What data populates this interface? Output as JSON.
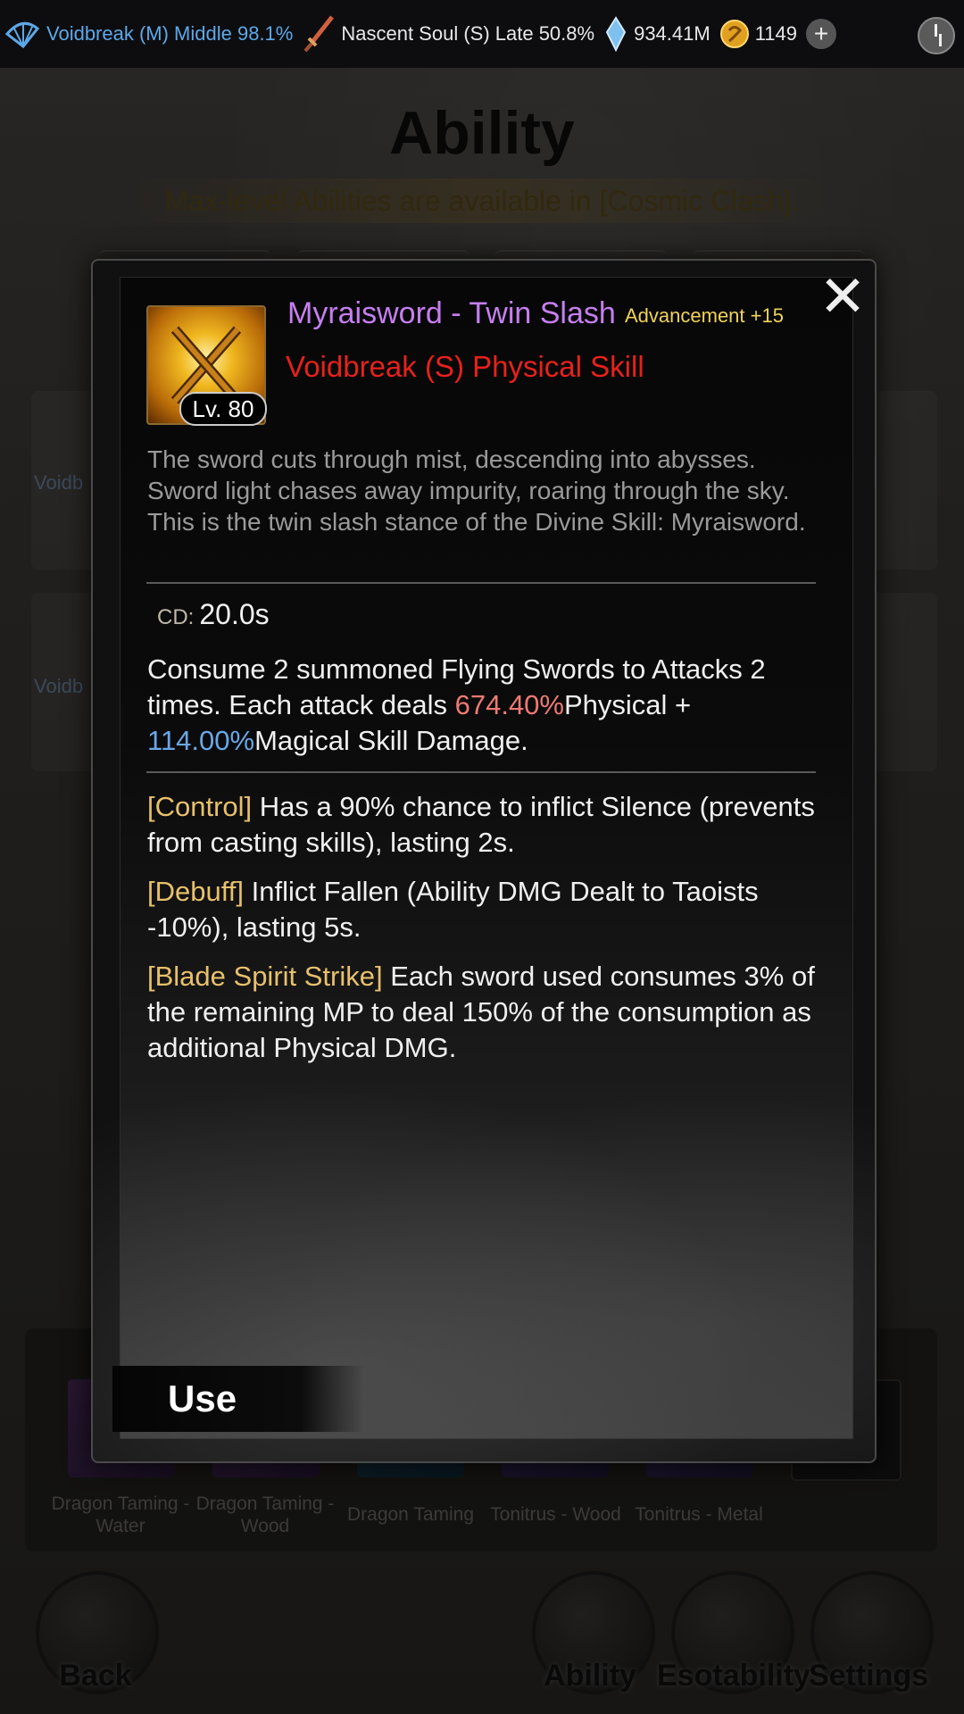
{
  "status_bar": {
    "realm": "Voidbreak (M) Middle 98.1%",
    "soul": "Nascent Soul (S) Late 50.8%",
    "crystals": "934.41M",
    "currency": "1149"
  },
  "page": {
    "title": "Ability",
    "subtitle": "Max-level Abilities are available in [Cosmic Clash].",
    "row_label_1": "Voidb",
    "row_label_2": "Voidb"
  },
  "bottom_slots": [
    {
      "label": "Dragon Taming - Water"
    },
    {
      "label": "Dragon Taming - Wood"
    },
    {
      "label": "Dragon Taming"
    },
    {
      "label": "Tonitrus - Wood"
    },
    {
      "label": "Tonitrus - Metal"
    }
  ],
  "bottom_nav": {
    "back": "Back",
    "ability": "Ability",
    "esotability": "Esotability",
    "settings": "Settings"
  },
  "modal": {
    "skill_name": "Myraisword - Twin Slash",
    "advancement": "Advancement +15",
    "skill_type": "Voidbreak (S) Physical Skill",
    "level": "Lv. 80",
    "description": "The sword cuts through mist, descending into abysses. Sword light chases away impurity, roaring through the sky. This is the twin slash stance of the Divine Skill: Myraisword.",
    "cd_label": "CD:",
    "cd_value": "20.0s",
    "main_effect": {
      "part1": "Consume 2 summoned Flying Swords to Attacks 2 times. Each attack deals ",
      "physical_pct": "674.40%",
      "part2": "Physical + ",
      "magical_pct": "114.00%",
      "part3": "Magical Skill Damage."
    },
    "effects": [
      {
        "tag": "[Control]",
        "text": " Has a 90% chance to inflict Silence (prevents from casting skills), lasting 2s."
      },
      {
        "tag": "[Debuff]",
        "text": " Inflict Fallen (Ability DMG Dealt to Taoists -10%), lasting 5s."
      },
      {
        "tag": "[Blade Spirit Strike]",
        "text": " Each sword used consumes 3% of the remaining MP to deal 150% of the consumption as additional Physical DMG."
      }
    ],
    "use_label": "Use",
    "close_symbol": "✕"
  }
}
